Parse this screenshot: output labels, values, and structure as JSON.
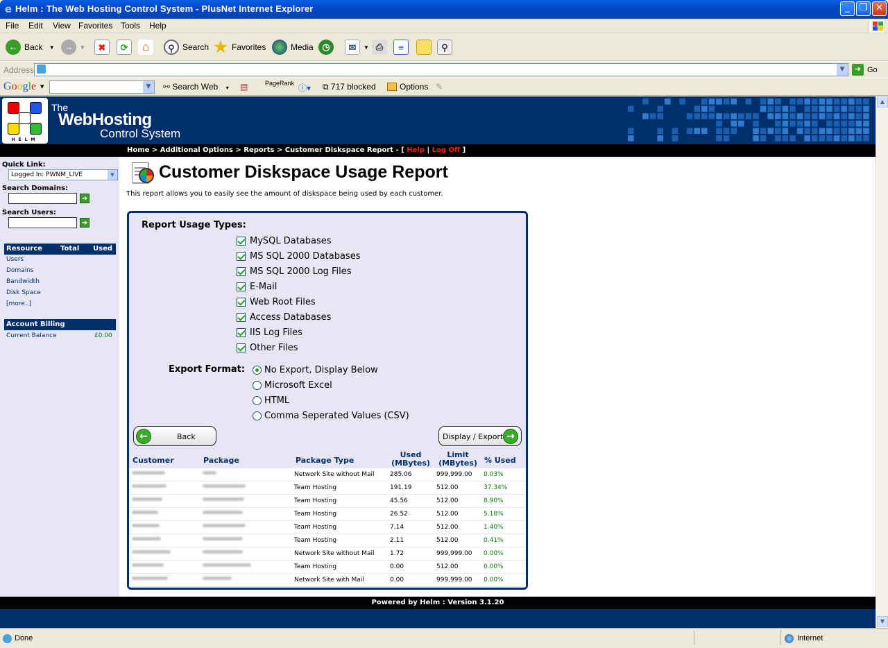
{
  "window": {
    "title": "Helm : The Web Hosting Control System - PlusNet Internet Explorer"
  },
  "menu": [
    "File",
    "Edit",
    "View",
    "Favorites",
    "Tools",
    "Help"
  ],
  "toolbar": {
    "back": "Back",
    "search": "Search",
    "favorites": "Favorites",
    "media": "Media"
  },
  "address": {
    "label": "Address",
    "value": "",
    "go": "Go"
  },
  "google": {
    "logo": "Google",
    "search_value": "",
    "search_web": "Search Web",
    "pagerank": "PageRank",
    "blocked": "717 blocked",
    "options": "Options"
  },
  "brand": {
    "line1": "The",
    "line2": "WebHosting",
    "line3": "Control System",
    "logo_text": "HELM"
  },
  "breadcrumb": {
    "path": "Home > Additional Options > Reports > Customer Diskspace Report - [",
    "help": "Help",
    "sep": " | ",
    "logoff": "Log Off",
    "end": " ]"
  },
  "sidebar": {
    "quick_link_label": "Quick Link:",
    "quick_link_value": "Logged In: PWNM_LIVE",
    "search_domains_label": "Search Domains:",
    "search_users_label": "Search Users:",
    "resource_header": {
      "resource": "Resource",
      "total": "Total",
      "used": "Used"
    },
    "resource_links": [
      "Users",
      "Domains",
      "Bandwidth",
      "Disk Space",
      "[more..]"
    ],
    "billing_header": "Account Billing",
    "balance_label": "Current Balance",
    "balance_value": "£0.00"
  },
  "page": {
    "title": "Customer Diskspace Usage Report",
    "description": "This report allows you to easily see the amount of diskspace being used by each customer."
  },
  "report": {
    "usage_types_label": "Report Usage Types:",
    "usage_types": [
      "MySQL Databases",
      "MS SQL 2000 Databases",
      "MS SQL 2000 Log Files",
      "E-Mail",
      "Web Root Files",
      "Access Databases",
      "IIS Log Files",
      "Other Files"
    ],
    "usage_types_checked": [
      true,
      true,
      true,
      true,
      true,
      true,
      true,
      true
    ],
    "export_label": "Export Format:",
    "export_options": [
      "No Export, Display Below",
      "Microsoft Excel",
      "HTML",
      "Comma Seperated Values (CSV)"
    ],
    "export_selected": "No Export, Display Below",
    "back_button": "Back",
    "display_button": "Display / Export"
  },
  "table": {
    "headers": {
      "customer": "Customer",
      "package": "Package",
      "package_type": "Package Type",
      "used": "Used (MBytes)",
      "limit": "Limit (MBytes)",
      "pct": "% Used"
    },
    "rows": [
      {
        "type": "Network Site without Mail",
        "used": "285.06",
        "limit": "999,999.00",
        "pct": "0.03%"
      },
      {
        "type": "Team Hosting",
        "used": "191.19",
        "limit": "512.00",
        "pct": "37.34%"
      },
      {
        "type": "Team Hosting",
        "used": "45.56",
        "limit": "512.00",
        "pct": "8.90%"
      },
      {
        "type": "Team Hosting",
        "used": "26.52",
        "limit": "512.00",
        "pct": "5.18%"
      },
      {
        "type": "Team Hosting",
        "used": "7.14",
        "limit": "512.00",
        "pct": "1.40%"
      },
      {
        "type": "Team Hosting",
        "used": "2.11",
        "limit": "512.00",
        "pct": "0.41%"
      },
      {
        "type": "Network Site without Mail",
        "used": "1.72",
        "limit": "999,999.00",
        "pct": "0.00%"
      },
      {
        "type": "Team Hosting",
        "used": "0.00",
        "limit": "512.00",
        "pct": "0.00%"
      },
      {
        "type": "Network Site with Mail",
        "used": "0.00",
        "limit": "999,999.00",
        "pct": "0.00%"
      }
    ]
  },
  "footer": {
    "text": "Powered by Helm  :  Version 3.1.20"
  },
  "status": {
    "left": "Done",
    "zone": "Internet"
  },
  "colors": {
    "navy": "#002f6c",
    "panel": "#e6e6f4",
    "link_red": "#e22",
    "pct_green": "#087a08"
  }
}
